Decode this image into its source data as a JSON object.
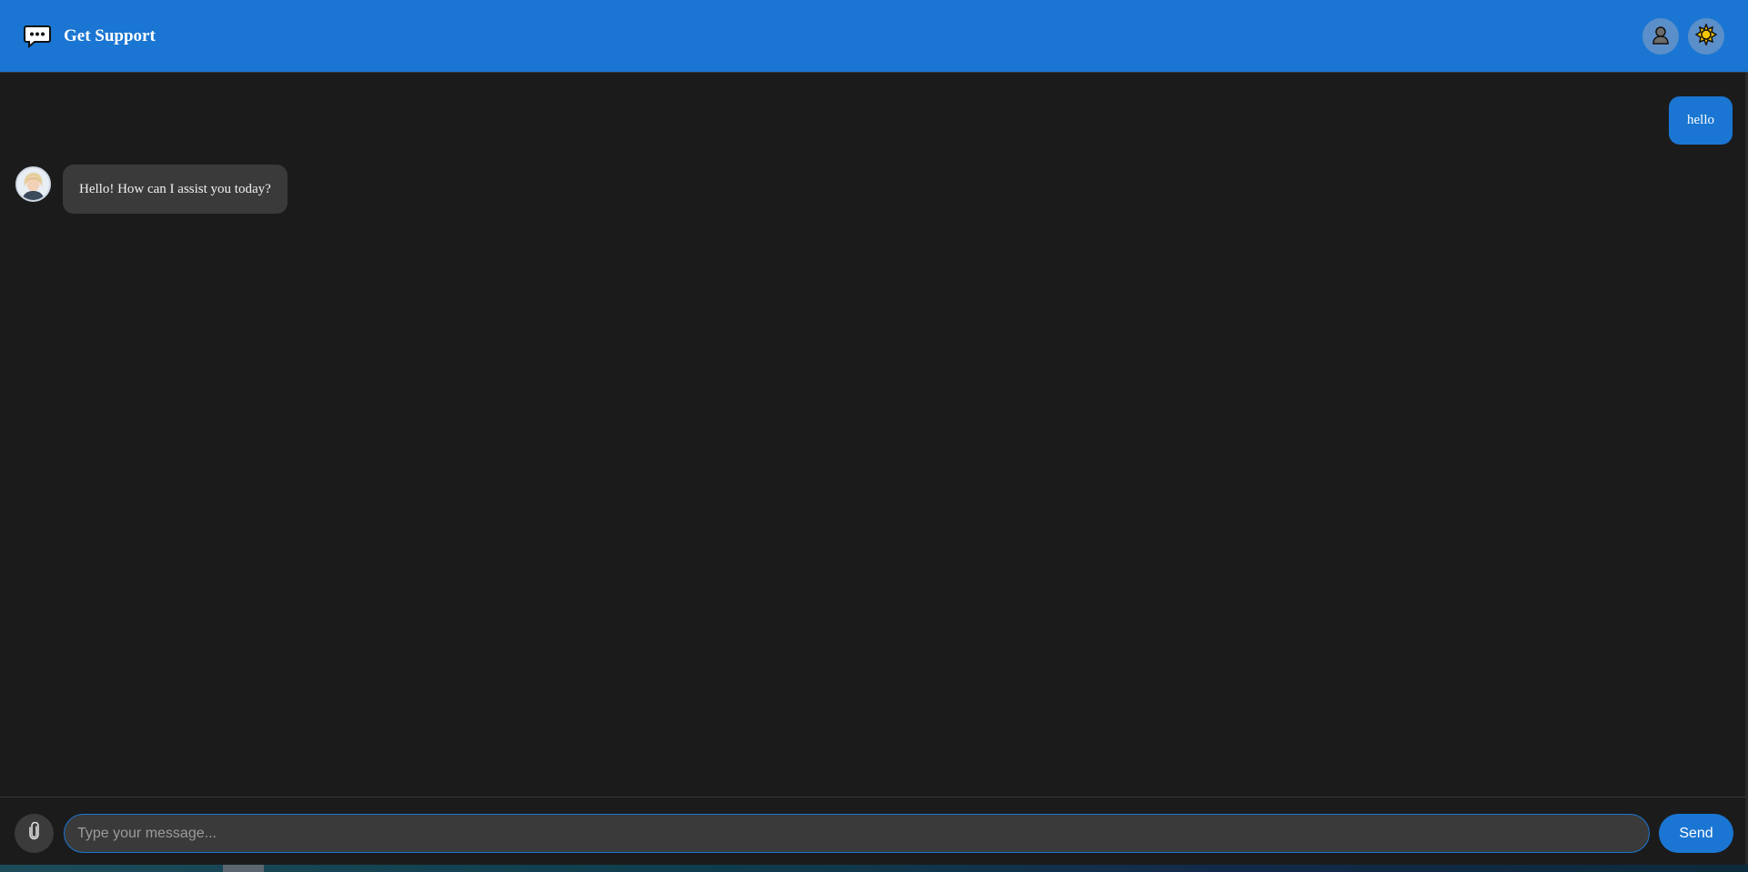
{
  "header": {
    "icon": "chat-bubble-icon",
    "title": "Get Support",
    "actions": [
      {
        "name": "profile-button",
        "icon": "user-icon"
      },
      {
        "name": "theme-toggle-button",
        "icon": "sun-icon"
      }
    ]
  },
  "messages": [
    {
      "from": "user",
      "text": "hello"
    },
    {
      "from": "agent",
      "text": "Hello! How can I assist you today?",
      "avatar": "support-agent-avatar"
    }
  ],
  "composer": {
    "attach_icon": "paperclip-icon",
    "placeholder": "Type your message...",
    "value": "",
    "send_label": "Send"
  },
  "colors": {
    "accent": "#1a76d2",
    "background": "#1b1b1b",
    "bubble_agent": "#3a3a3a",
    "sun": "#f6c400"
  }
}
